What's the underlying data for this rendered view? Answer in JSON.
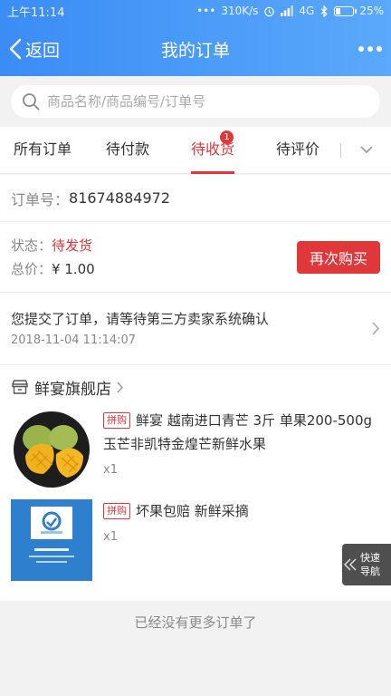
{
  "status_bar": {
    "time": "上午11:14",
    "dots": "•••",
    "speed": "310K/s",
    "network": "4G",
    "battery": "25%",
    "battery_level": 0.25
  },
  "header": {
    "back_label": "返回",
    "title": "我的订单",
    "more_icon": "more-dots-icon"
  },
  "search": {
    "placeholder": "商品名称/商品编号/订单号",
    "value": ""
  },
  "tabs": [
    {
      "label": "所有订单"
    },
    {
      "label": "待付款"
    },
    {
      "label": "待收货",
      "badge": "1"
    },
    {
      "label": "待评价"
    }
  ],
  "order": {
    "number_label": "订单号：",
    "number": "81674884972",
    "status_label": "状态：",
    "status": "待发货",
    "total_label": "总价：",
    "total": "¥ 1.00",
    "rebuy_label": "再次购买",
    "message": "您提交了订单，请等待第三方卖家系统确认",
    "message_time": "2018-11-04 11:14:07",
    "shop_name": "鲜宴旗舰店",
    "items": [
      {
        "tag": "拼购",
        "title": "鲜宴 越南进口青芒 3斤 单果200-500g 玉芒非凯特金煌芒新鲜水果",
        "qty": "x1"
      },
      {
        "tag": "拼购",
        "title": "坏果包赔 新鲜采摘",
        "qty": "x1"
      }
    ]
  },
  "quick_nav": {
    "line1": "快速",
    "line2": "导航"
  },
  "footer": "已经没有更多订单了",
  "colors": {
    "accent_red": "#e0373a",
    "header_blue": "#3b8cf5"
  }
}
